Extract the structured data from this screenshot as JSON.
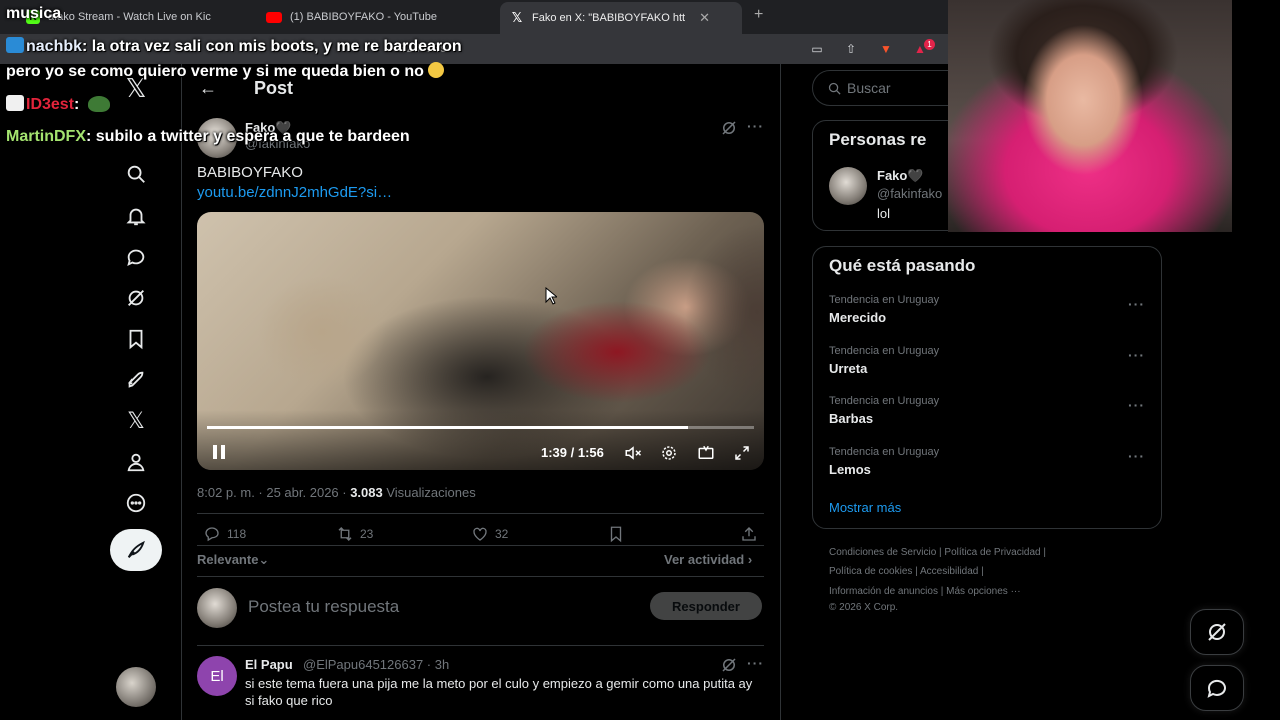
{
  "overlay": {
    "title": "musica",
    "chat": [
      {
        "user": "nachbk",
        "message": "la otra vez sali con mis boots, y me re bardearon"
      },
      {
        "user": "",
        "message": "pero yo se como quiero verme y si me queda bien o no"
      },
      {
        "user": "ID3est",
        "message": ""
      },
      {
        "user": "MartinDFX",
        "message": "subilo a twitter y espera a que te bardeen"
      }
    ]
  },
  "browser": {
    "tabs": [
      {
        "label": "afako Stream - Watch Live on Kic",
        "icon": "kick-icon"
      },
      {
        "label": "(1) BABIBOYFAKO - YouTube",
        "icon": "youtube-icon"
      },
      {
        "label": "Fako    en X: \"BABIBOYFAKO htt",
        "icon": "x-icon"
      }
    ],
    "url_fragment": "8260139",
    "notification_count": "1"
  },
  "post": {
    "header": "Post",
    "author_name": "Fako🖤",
    "author_handle": "@fakinfako",
    "text": "BABIBOYFAKO",
    "link": "youtu.be/zdnnJ2mhGdE?si…",
    "video_time": "1:39 / 1:56",
    "video_progress": 0.88,
    "timestamp": "8:02 p. m. · 25 abr. 2026 · ",
    "views": "3.083",
    "views_label": " Visualizaciones",
    "replies": "118",
    "reposts": "23",
    "likes": "32",
    "sort_label": "Relevante⌄",
    "activity_label": "Ver actividad ›",
    "reply_placeholder": "Postea tu respuesta",
    "reply_button": "Responder"
  },
  "comment": {
    "avatar_letters": "El",
    "name": "El Papu",
    "handle": "@ElPapu645126637 · 3h",
    "text": "si este tema fuera una pija me la meto por el culo y empiezo a gemir como una putita ay si fako que rico"
  },
  "sidebar": {
    "search_placeholder": "Buscar",
    "people_title": "Personas re",
    "person": {
      "name": "Fako🖤",
      "handle": "@fakinfako",
      "bio": "lol"
    },
    "trends_title": "Qué está pasando",
    "trends": [
      {
        "category": "Tendencia en Uruguay",
        "name": "Merecido"
      },
      {
        "category": "Tendencia en Uruguay",
        "name": "Urreta"
      },
      {
        "category": "Tendencia en Uruguay",
        "name": "Barbas"
      },
      {
        "category": "Tendencia en Uruguay",
        "name": "Lemos"
      }
    ],
    "show_more": "Mostrar más",
    "footer": [
      "Condiciones de Servicio  |  Política de Privacidad  |",
      "Política de cookies  |  Accesibilidad  |",
      "Información de anuncios  |  Más opciones ···",
      "© 2026 X Corp."
    ]
  }
}
